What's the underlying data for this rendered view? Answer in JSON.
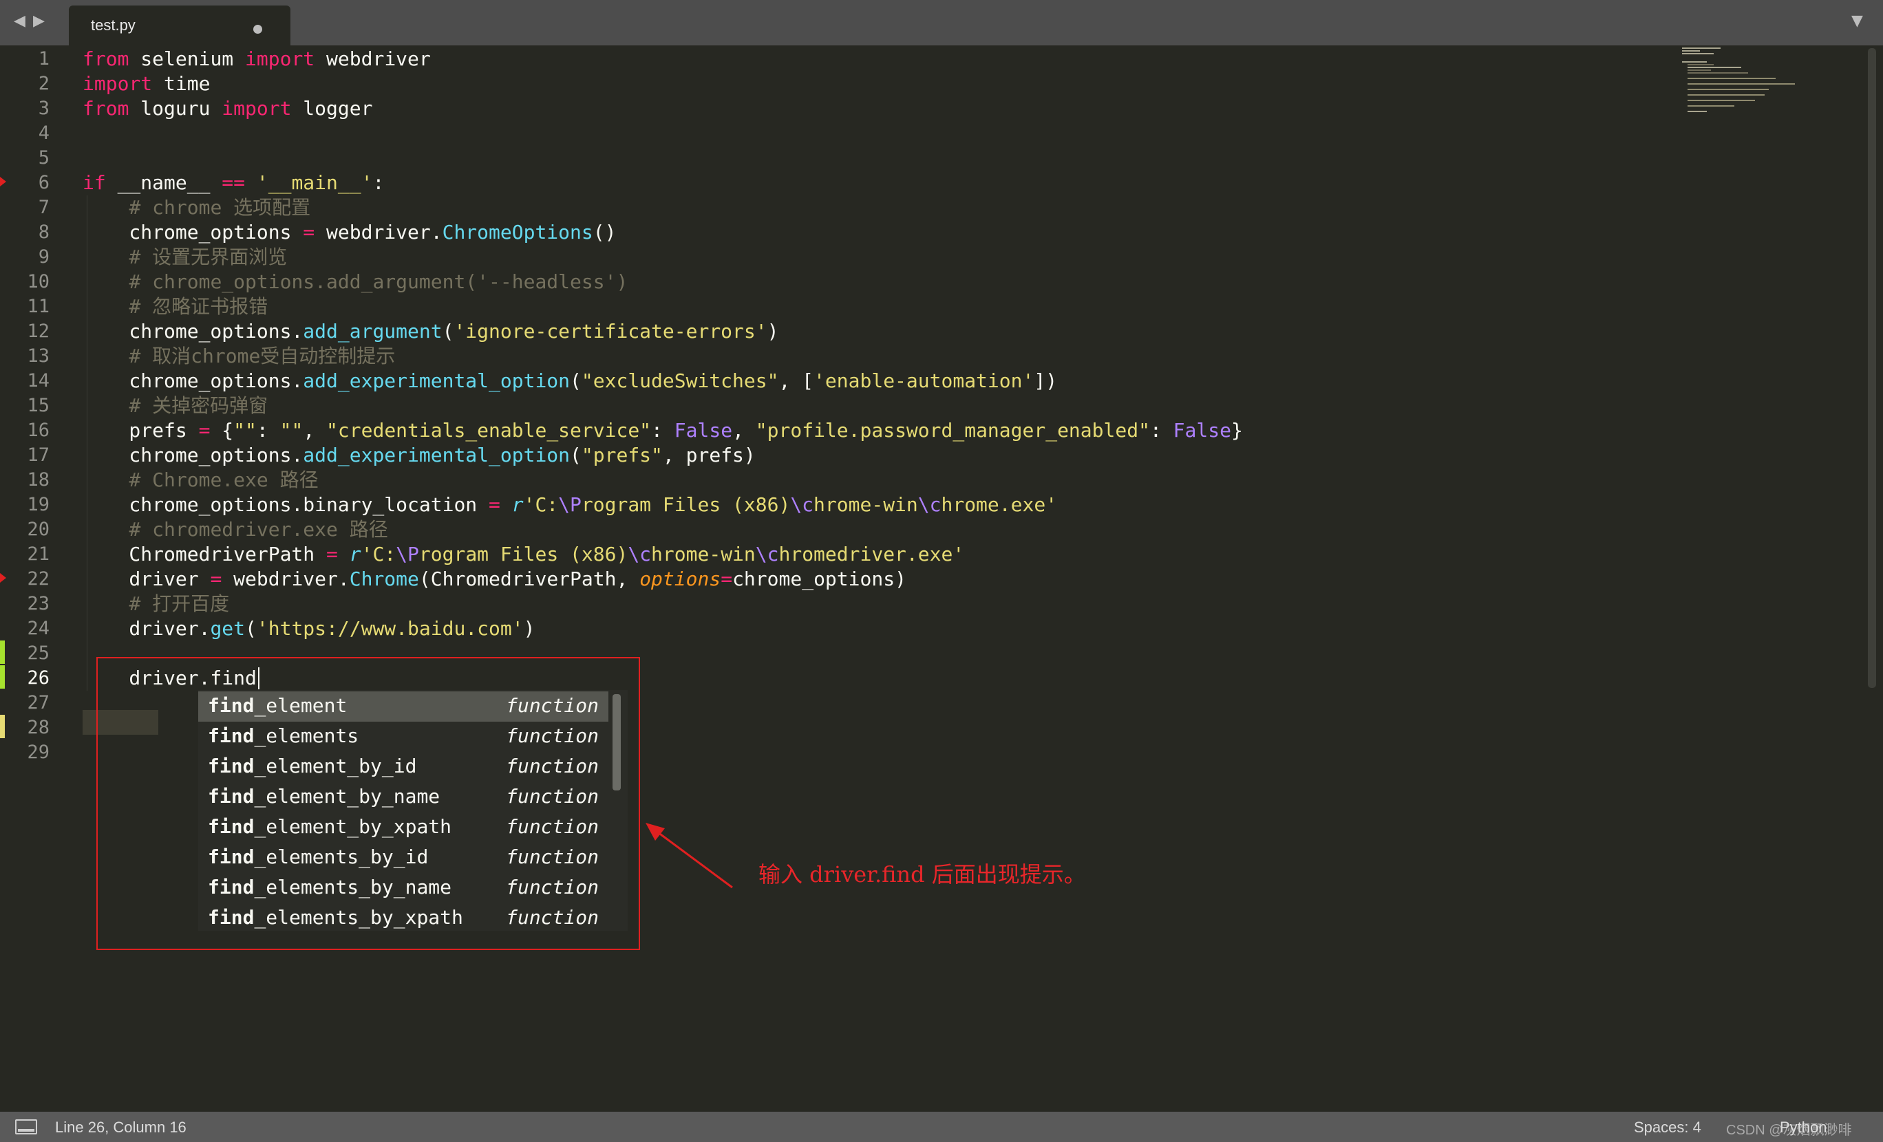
{
  "tabbar": {
    "nav_left": "◀",
    "nav_right": "▶",
    "tab_title": "test.py",
    "menu_icon": "▼"
  },
  "gutter": {
    "line_numbers": [
      "1",
      "2",
      "3",
      "4",
      "5",
      "6",
      "7",
      "8",
      "9",
      "10",
      "11",
      "12",
      "13",
      "14",
      "15",
      "16",
      "17",
      "18",
      "19",
      "20",
      "21",
      "22",
      "23",
      "24",
      "25",
      "26",
      "27",
      "28",
      "29"
    ],
    "active_line": "26"
  },
  "code": {
    "lines": [
      [
        {
          "t": "from",
          "c": "kw"
        },
        {
          "t": " selenium "
        },
        {
          "t": "import",
          "c": "kw"
        },
        {
          "t": " webdriver"
        }
      ],
      [
        {
          "t": "import",
          "c": "kw"
        },
        {
          "t": " time"
        }
      ],
      [
        {
          "t": "from",
          "c": "kw"
        },
        {
          "t": " loguru "
        },
        {
          "t": "import",
          "c": "kw"
        },
        {
          "t": " logger"
        }
      ],
      [],
      [],
      [
        {
          "t": "if",
          "c": "kw"
        },
        {
          "t": " __name__ "
        },
        {
          "t": "==",
          "c": "kw"
        },
        {
          "t": " "
        },
        {
          "t": "'__main__'",
          "c": "str"
        },
        {
          "t": ":"
        }
      ],
      [
        {
          "t": "    "
        },
        {
          "t": "# chrome 选项配置",
          "c": "cmt"
        }
      ],
      [
        {
          "t": "    chrome_options "
        },
        {
          "t": "=",
          "c": "kw"
        },
        {
          "t": " webdriver."
        },
        {
          "t": "ChromeOptions",
          "c": "fn"
        },
        {
          "t": "()"
        }
      ],
      [
        {
          "t": "    "
        },
        {
          "t": "# 设置无界面浏览",
          "c": "cmt"
        }
      ],
      [
        {
          "t": "    "
        },
        {
          "t": "# chrome_options.add_argument('--headless')",
          "c": "cmt"
        }
      ],
      [
        {
          "t": "    "
        },
        {
          "t": "# 忽略证书报错",
          "c": "cmt"
        }
      ],
      [
        {
          "t": "    chrome_options."
        },
        {
          "t": "add_argument",
          "c": "fn"
        },
        {
          "t": "("
        },
        {
          "t": "'ignore-certificate-errors'",
          "c": "str"
        },
        {
          "t": ")"
        }
      ],
      [
        {
          "t": "    "
        },
        {
          "t": "# 取消chrome受自动控制提示",
          "c": "cmt"
        }
      ],
      [
        {
          "t": "    chrome_options."
        },
        {
          "t": "add_experimental_option",
          "c": "fn"
        },
        {
          "t": "("
        },
        {
          "t": "\"excludeSwitches\"",
          "c": "str"
        },
        {
          "t": ", ["
        },
        {
          "t": "'enable-automation'",
          "c": "str"
        },
        {
          "t": "])"
        }
      ],
      [
        {
          "t": "    "
        },
        {
          "t": "# 关掉密码弹窗",
          "c": "cmt"
        }
      ],
      [
        {
          "t": "    prefs "
        },
        {
          "t": "=",
          "c": "kw"
        },
        {
          "t": " {"
        },
        {
          "t": "\"\"",
          "c": "str"
        },
        {
          "t": ": "
        },
        {
          "t": "\"\"",
          "c": "str"
        },
        {
          "t": ", "
        },
        {
          "t": "\"credentials_enable_service\"",
          "c": "str"
        },
        {
          "t": ": "
        },
        {
          "t": "False",
          "c": "cst"
        },
        {
          "t": ", "
        },
        {
          "t": "\"profile.password_manager_enabled\"",
          "c": "str"
        },
        {
          "t": ": "
        },
        {
          "t": "False",
          "c": "cst"
        },
        {
          "t": "}"
        }
      ],
      [
        {
          "t": "    chrome_options."
        },
        {
          "t": "add_experimental_option",
          "c": "fn"
        },
        {
          "t": "("
        },
        {
          "t": "\"prefs\"",
          "c": "str"
        },
        {
          "t": ", prefs)"
        }
      ],
      [
        {
          "t": "    "
        },
        {
          "t": "# Chrome.exe 路径",
          "c": "cmt"
        }
      ],
      [
        {
          "t": "    chrome_options.binary_location "
        },
        {
          "t": "=",
          "c": "kw"
        },
        {
          "t": " "
        },
        {
          "t": "r",
          "c": "fn ital"
        },
        {
          "t": "'C:",
          "c": "str"
        },
        {
          "t": "\\P",
          "c": "cst"
        },
        {
          "t": "rogram Files (x86)",
          "c": "str"
        },
        {
          "t": "\\c",
          "c": "cst"
        },
        {
          "t": "hrome-win",
          "c": "str"
        },
        {
          "t": "\\c",
          "c": "cst"
        },
        {
          "t": "hrome.exe'",
          "c": "str"
        }
      ],
      [
        {
          "t": "    "
        },
        {
          "t": "# chromedriver.exe 路径",
          "c": "cmt"
        }
      ],
      [
        {
          "t": "    ChromedriverPath "
        },
        {
          "t": "=",
          "c": "kw"
        },
        {
          "t": " "
        },
        {
          "t": "r",
          "c": "fn ital"
        },
        {
          "t": "'C:",
          "c": "str"
        },
        {
          "t": "\\P",
          "c": "cst"
        },
        {
          "t": "rogram Files (x86)",
          "c": "str"
        },
        {
          "t": "\\c",
          "c": "cst"
        },
        {
          "t": "hrome-win",
          "c": "str"
        },
        {
          "t": "\\c",
          "c": "cst"
        },
        {
          "t": "hromedriver.exe'",
          "c": "str"
        }
      ],
      [
        {
          "t": "    driver "
        },
        {
          "t": "=",
          "c": "kw"
        },
        {
          "t": " webdriver."
        },
        {
          "t": "Chrome",
          "c": "fn"
        },
        {
          "t": "(ChromedriverPath, "
        },
        {
          "t": "options",
          "c": "param"
        },
        {
          "t": "=",
          "c": "kw"
        },
        {
          "t": "chrome_options)"
        }
      ],
      [
        {
          "t": "    "
        },
        {
          "t": "# 打开百度",
          "c": "cmt"
        }
      ],
      [
        {
          "t": "    driver."
        },
        {
          "t": "get",
          "c": "fn"
        },
        {
          "t": "("
        },
        {
          "t": "'https://www.baidu.com'",
          "c": "str"
        },
        {
          "t": ")"
        }
      ],
      [],
      [
        {
          "t": "    driver.find"
        }
      ],
      [],
      [],
      []
    ]
  },
  "autocomplete": {
    "typed": "find",
    "items": [
      {
        "rest": "_element",
        "kind": "function"
      },
      {
        "rest": "_elements",
        "kind": "function"
      },
      {
        "rest": "_element_by_id",
        "kind": "function"
      },
      {
        "rest": "_element_by_name",
        "kind": "function"
      },
      {
        "rest": "_element_by_xpath",
        "kind": "function"
      },
      {
        "rest": "_elements_by_id",
        "kind": "function"
      },
      {
        "rest": "_elements_by_name",
        "kind": "function"
      },
      {
        "rest": "_elements_by_xpath",
        "kind": "function"
      }
    ],
    "selected_index": 0
  },
  "annotation": {
    "text": "输入 driver.find 后面出现提示。",
    "color": "#e8262a"
  },
  "statusbar": {
    "position": "Line 26, Column 16",
    "spaces": "Spaces: 4",
    "syntax": "Python",
    "watermark": "CSDN @灰烟飘渺啡"
  },
  "colors": {
    "background": "#272822",
    "keyword": "#f92672",
    "string": "#e6db74",
    "comment": "#75715e",
    "function": "#66d9ef",
    "constant": "#ae81ff",
    "parameter": "#fd971f"
  }
}
